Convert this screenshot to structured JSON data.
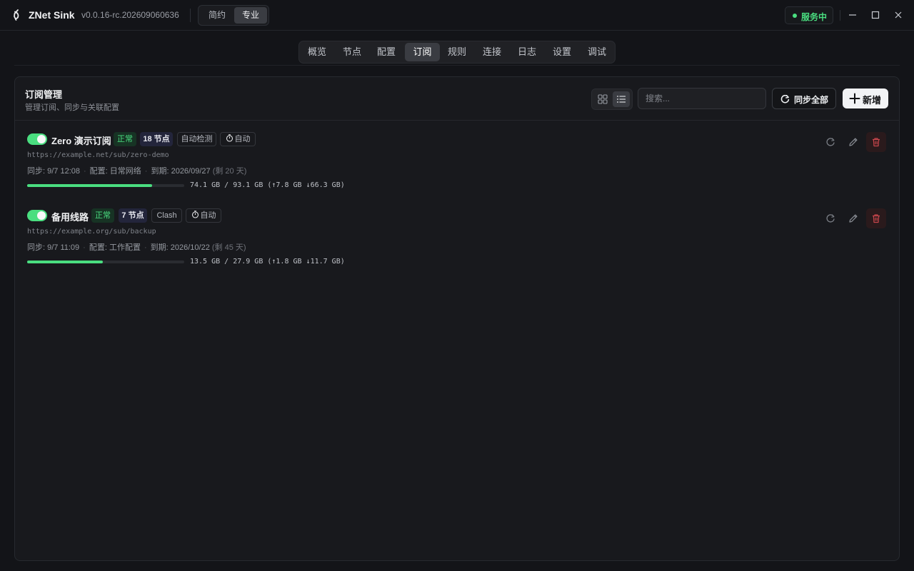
{
  "app": {
    "name": "ZNet Sink",
    "version": "v0.0.16-rc.202609060636",
    "modes": [
      "简约",
      "专业"
    ],
    "active_mode": "专业",
    "status": "服务中",
    "status_color": "#4ade80"
  },
  "tabs": [
    {
      "label": "概览"
    },
    {
      "label": "节点"
    },
    {
      "label": "配置"
    },
    {
      "label": "订阅",
      "active": true
    },
    {
      "label": "规则"
    },
    {
      "label": "连接"
    },
    {
      "label": "日志"
    },
    {
      "label": "设置"
    },
    {
      "label": "调试"
    }
  ],
  "panel": {
    "title": "订阅管理",
    "subtitle": "管理订阅、同步与关联配置",
    "search_placeholder": "搜索...",
    "sync_all_label": "同步全部",
    "add_label": "新增",
    "view_mode": "list"
  },
  "subscriptions": [
    {
      "enabled": true,
      "name": "Zero 演示订阅",
      "status": "正常",
      "nodes": "18 节点",
      "type": "自动检测",
      "update": "自动",
      "url": "https://example.net/sub/zero-demo",
      "sync": "同步: 9/7 12:08",
      "config": "配置: 日常网络",
      "expire": "到期: 2026/09/27",
      "remaining": "(剩 20 天)",
      "usage_fraction": 0.795,
      "traffic": "74.1 GB / 93.1 GB (↑7.8 GB ↓66.3 GB)"
    },
    {
      "enabled": true,
      "name": "备用线路",
      "status": "正常",
      "nodes": "7 节点",
      "type": "Clash",
      "update": "自动",
      "url": "https://example.org/sub/backup",
      "sync": "同步: 9/7 11:09",
      "config": "配置: 工作配置",
      "expire": "到期: 2026/10/22",
      "remaining": "(剩 45 天)",
      "usage_fraction": 0.484,
      "traffic": "13.5 GB / 27.9 GB (↑1.8 GB ↓11.7 GB)"
    }
  ]
}
